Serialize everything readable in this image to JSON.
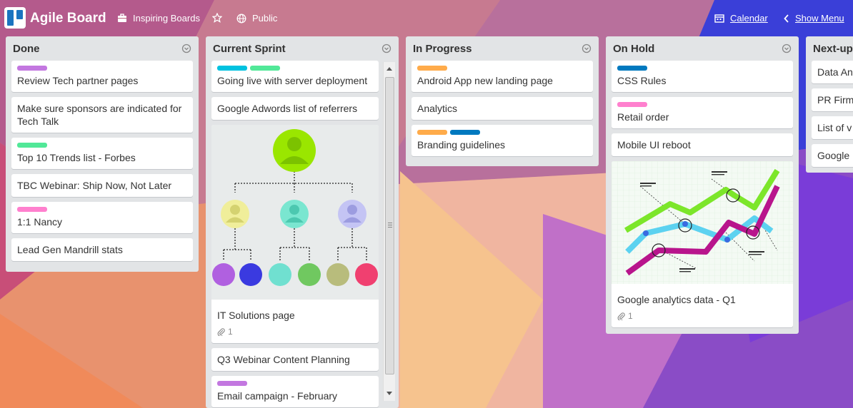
{
  "header": {
    "board_title": "Agile Board",
    "org_name": "Inspiring Boards",
    "visibility": "Public",
    "calendar_label": "Calendar",
    "show_menu_label": "Show Menu"
  },
  "lists": [
    {
      "title": "Done",
      "cards": [
        {
          "labels": [
            "#c377e0"
          ],
          "title": "Review Tech partner pages"
        },
        {
          "labels": [],
          "title": "Make sure sponsors are indicated for Tech Talk"
        },
        {
          "labels": [
            "#51e898"
          ],
          "title": "Top 10 Trends list - Forbes"
        },
        {
          "labels": [],
          "title": "TBC Webinar: Ship Now, Not Later"
        },
        {
          "labels": [
            "#ff80ce"
          ],
          "title": "1:1 Nancy"
        },
        {
          "labels": [],
          "title": "Lead Gen Mandrill stats"
        }
      ]
    },
    {
      "title": "Current Sprint",
      "cards": [
        {
          "labels": [
            "#00c2e0",
            "#51e898"
          ],
          "title": "Going live with server deployment"
        },
        {
          "labels": [],
          "title": "Google Adwords list of referrers"
        },
        {
          "labels": [],
          "title": "IT Solutions page",
          "attachments": "1",
          "cover": "org-chart"
        },
        {
          "labels": [],
          "title": "Q3 Webinar Content Planning"
        },
        {
          "labels": [
            "#c377e0"
          ],
          "title": "Email campaign - February"
        }
      ]
    },
    {
      "title": "In Progress",
      "cards": [
        {
          "labels": [
            "#ffab4a"
          ],
          "title": "Android App new landing page"
        },
        {
          "labels": [],
          "title": "Analytics"
        },
        {
          "labels": [
            "#ffab4a",
            "#0079bf"
          ],
          "title": "Branding guidelines"
        }
      ]
    },
    {
      "title": "On Hold",
      "cards": [
        {
          "labels": [
            "#0079bf"
          ],
          "title": "CSS Rules"
        },
        {
          "labels": [
            "#ff80ce"
          ],
          "title": "Retail order"
        },
        {
          "labels": [],
          "title": "Mobile UI reboot"
        },
        {
          "labels": [],
          "title": "Google analytics data - Q1",
          "attachments": "1",
          "cover": "line-chart"
        }
      ]
    },
    {
      "title": "Next-up",
      "cards": [
        {
          "labels": [],
          "title": "Data An"
        },
        {
          "labels": [],
          "title": "PR Firm"
        },
        {
          "labels": [],
          "title": "List of v"
        },
        {
          "labels": [],
          "title": "Google"
        }
      ]
    }
  ],
  "colors": {
    "brand": "#1a74c0",
    "list_bg": "#e2e4e6",
    "card_bg": "#ffffff"
  }
}
